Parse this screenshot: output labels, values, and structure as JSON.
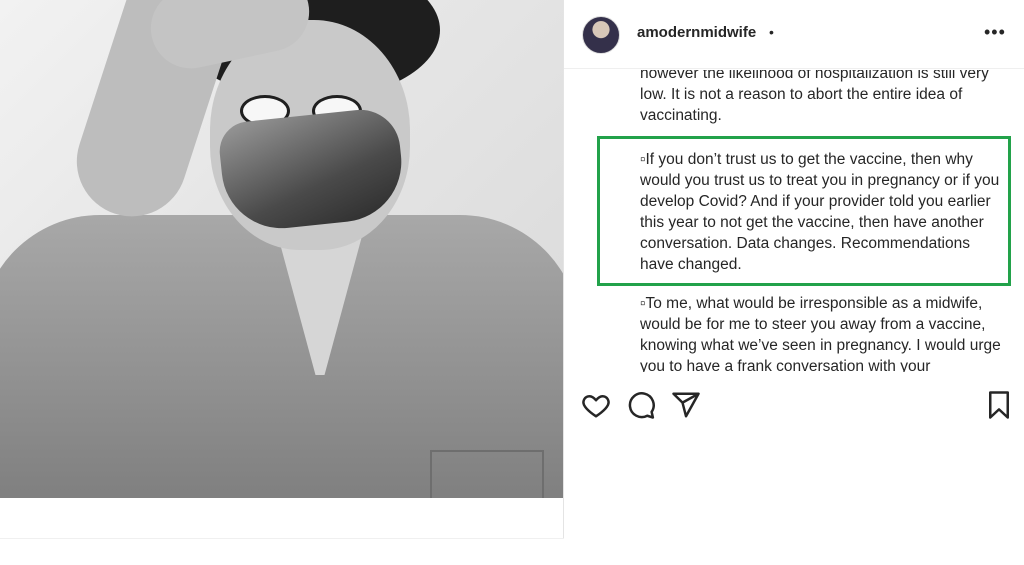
{
  "post": {
    "username": "amodernmidwife",
    "bullet": "•",
    "more_icon": "more-horizontal-icon",
    "more_label": "•••",
    "caption": {
      "p1": "however the likelihood of hospitalization is still very low. It is not a reason to abort the entire idea of vaccinating.",
      "p2": "▫If you don’t trust us to get the vaccine, then why would you trust us to treat you in pregnancy or if you develop Covid? And if your provider told you earlier this year to not get the vaccine, then have another conversation. Data changes. Recommendations have changed.",
      "p3": "▫To me, what would be irresponsible as a midwife, would be for me to steer you away from a vaccine, knowing what we’ve seen in pregnancy. I would urge you to have a frank conversation with your"
    },
    "actions": [
      "heart-icon",
      "comment-icon",
      "share-icon",
      "bookmark-icon"
    ],
    "colors": {
      "highlight_border": "#22a24a",
      "text": "#262626"
    }
  }
}
